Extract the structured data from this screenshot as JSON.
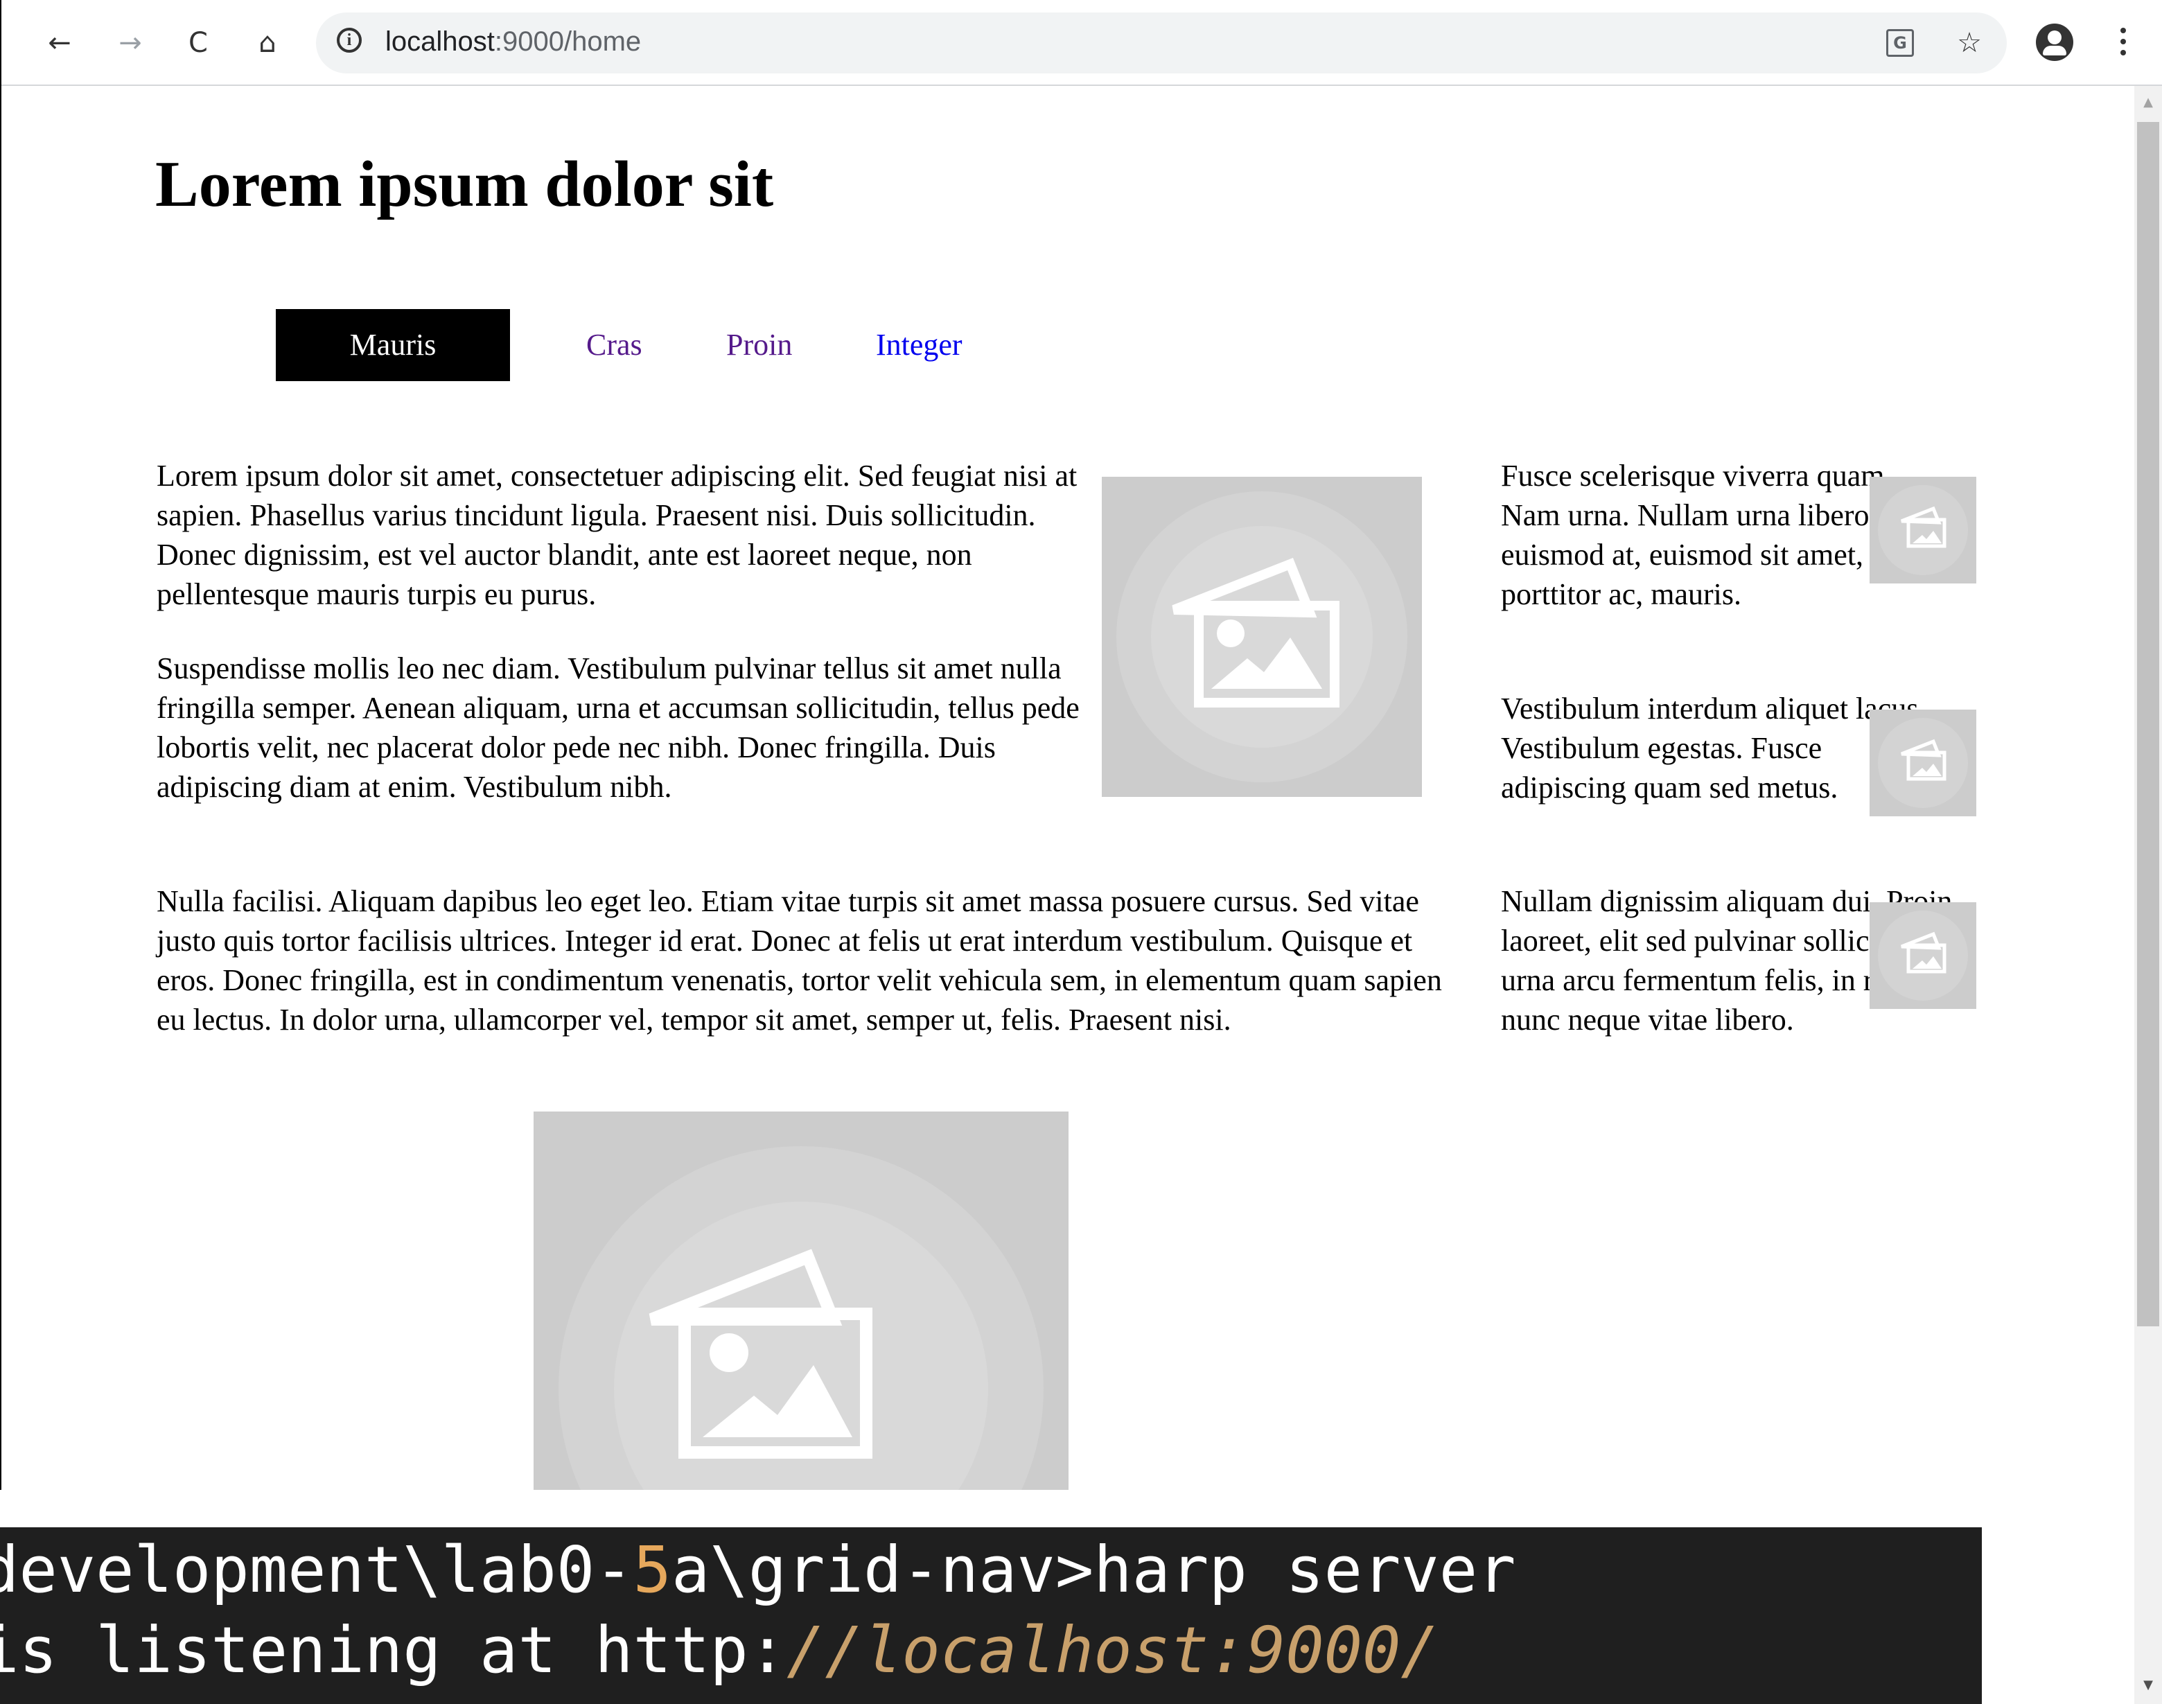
{
  "browser": {
    "back_icon": "←",
    "forward_icon": "→",
    "reload_icon": "C",
    "home_icon": "⌂",
    "info_icon": "i",
    "url_host": "localhost",
    "url_rest": ":9000/home",
    "translate_icon": "G",
    "star_icon": "☆"
  },
  "page": {
    "title": "Lorem ipsum dolor sit",
    "menu": [
      {
        "label": "Mauris",
        "state": "active"
      },
      {
        "label": "Cras",
        "state": "visited"
      },
      {
        "label": "Proin",
        "state": "visited"
      },
      {
        "label": "Integer",
        "state": "link"
      }
    ],
    "main": {
      "p1": "Lorem ipsum dolor sit amet, consectetuer adipiscing elit. Sed feugiat nisi at sapien. Phasellus varius tincidunt ligula. Praesent nisi. Duis sollicitudin. Donec dignissim, est vel auctor blandit, ante est laoreet neque, non pellentesque mauris turpis eu purus.",
      "p2": "Suspendisse mollis leo nec diam. Vestibulum pulvinar tellus sit amet nulla fringilla semper. Aenean aliquam, urna et accumsan sollicitudin, tellus pede lobortis velit, nec placerat dolor pede nec nibh. Donec fringilla. Duis adipiscing diam at enim. Vestibulum nibh.",
      "p3": "Nulla facilisi. Aliquam dapibus leo eget leo. Etiam vitae turpis sit amet massa posuere cursus. Sed vitae justo quis tortor facilisis ultrices. Integer id erat. Donec at felis ut erat interdum vestibulum. Quisque et eros. Donec fringilla, est in condimentum venenatis, tortor velit vehicula sem, in elementum quam sapien eu lectus. In dolor urna, ullamcorper vel, tempor sit amet, semper ut, felis. Praesent nisi."
    },
    "sidebar": {
      "items": [
        {
          "text": "Fusce scelerisque viverra quam. Nam urna. Nullam urna libero, euismod at, euismod sit amet, porttitor ac, mauris."
        },
        {
          "text": "Vestibulum interdum aliquet lacus. Vestibulum egestas. Fusce adipiscing quam sed metus."
        },
        {
          "text": "Nullam dignissim aliquam dui. Proin laoreet, elit sed pulvinar sollicitudin, urna arcu fermentum felis, in rhoncus nunc neque vitae libero."
        }
      ]
    }
  },
  "terminal": {
    "line1_a": "development\\lab0-",
    "line1_num": "5",
    "line1_b": "a\\grid-nav>harp server",
    "line2_a": " is listening at http:",
    "line2_url": "//localhost:9000/"
  },
  "colors": {
    "active_menu_bg": "#000000",
    "visited_link": "#551a8b",
    "link": "#0000ee",
    "placeholder_bg": "#cccccc",
    "terminal_bg": "#1f1f1f"
  }
}
